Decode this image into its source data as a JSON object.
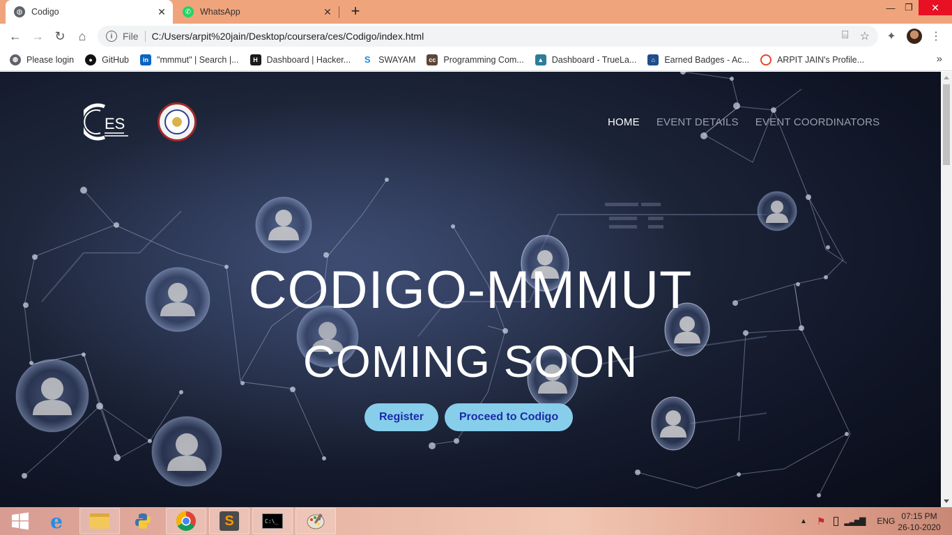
{
  "browser": {
    "tabs": [
      {
        "title": "Codigo",
        "active": true,
        "icon": "globe-icon"
      },
      {
        "title": "WhatsApp",
        "active": false,
        "icon": "whatsapp-icon"
      }
    ],
    "address": {
      "scheme_label": "File",
      "url": "C:/Users/arpit%20jain/Desktop/coursera/ces/Codigo/index.html"
    },
    "bookmarks": [
      {
        "label": "Please login",
        "icon": "globe-icon",
        "color": "#5f6368"
      },
      {
        "label": "GitHub",
        "icon": "github-icon",
        "color": "#111111"
      },
      {
        "label": "\"mmmut\" | Search |...",
        "icon": "linkedin-icon",
        "color": "#0a66c2"
      },
      {
        "label": "Dashboard | Hacker...",
        "icon": "hackerearth-icon",
        "color": "#1b1b1b"
      },
      {
        "label": "SWAYAM",
        "icon": "swayam-icon",
        "color": "#1e88e5"
      },
      {
        "label": "Programming Com...",
        "icon": "codechef-icon",
        "color": "#5b4638"
      },
      {
        "label": "Dashboard - TrueLa...",
        "icon": "truelancer-icon",
        "color": "#2d7d9a"
      },
      {
        "label": "Earned Badges - Ac...",
        "icon": "credly-icon",
        "color": "#1f4e8c"
      },
      {
        "label": "ARPIT JAIN's Profile...",
        "icon": "hackerrank-icon",
        "color": "#e8442e"
      }
    ]
  },
  "page": {
    "nav": {
      "home": "HOME",
      "event_details": "EVENT DETAILS",
      "event_coordinators": "EVENT COORDINATORS"
    },
    "logo_text": "ES",
    "hero": {
      "line1": "CODIGO-MMMUT",
      "line2": "COMING SOON"
    },
    "buttons": {
      "register": "Register",
      "proceed": "Proceed to Codigo"
    }
  },
  "taskbar": {
    "language": "ENG",
    "time": "07:15 PM",
    "date": "26-10-2020"
  },
  "colors": {
    "tab_strip": "#f0a47c",
    "button_bg": "#87ceeb",
    "button_text": "#1a2ca8",
    "page_bg": "#141a2c"
  }
}
